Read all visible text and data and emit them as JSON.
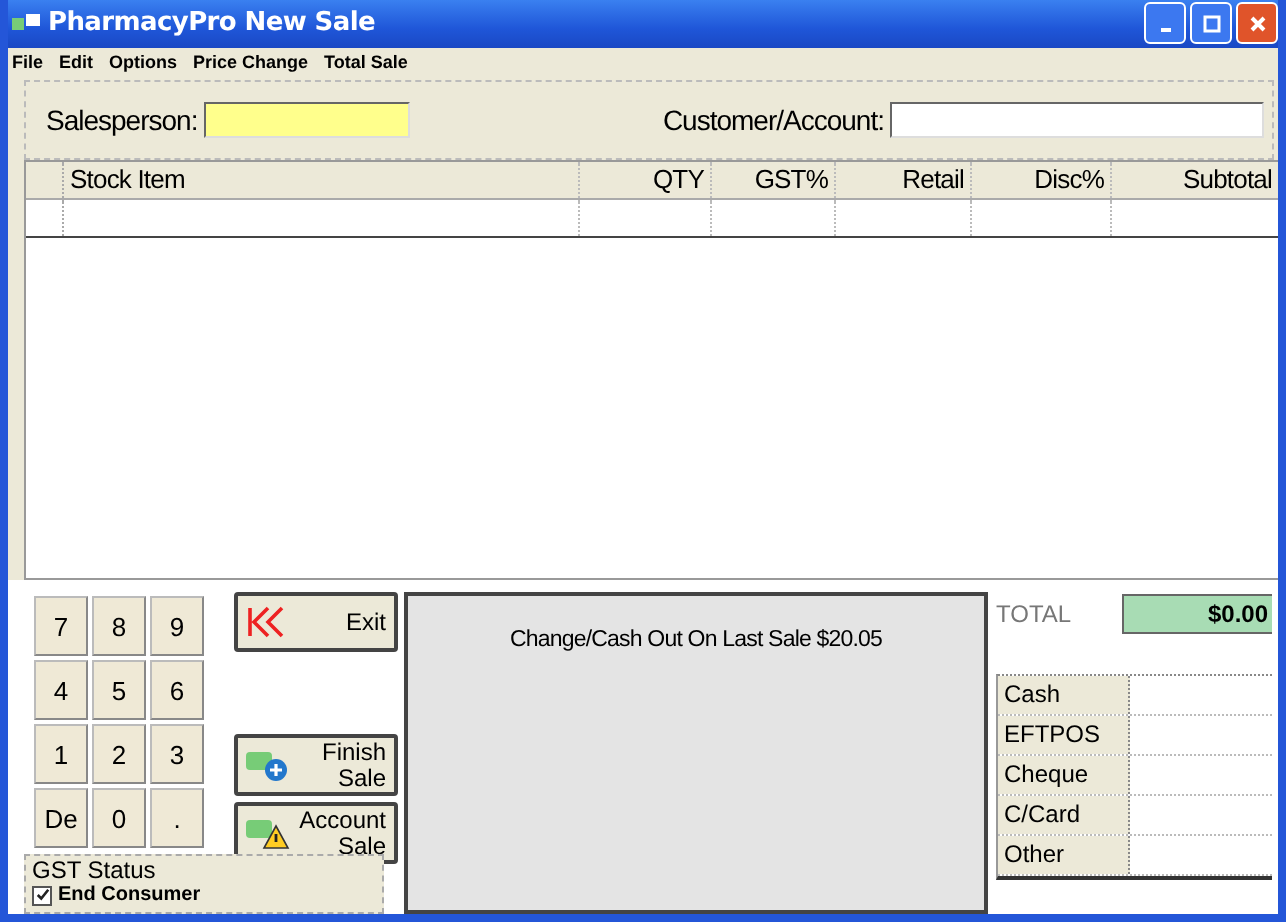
{
  "window": {
    "title": "PharmacyPro New Sale"
  },
  "menu": [
    "File",
    "Edit",
    "Options",
    "Price Change",
    "Total Sale"
  ],
  "salesperson": {
    "label": "Salesperson:"
  },
  "customer": {
    "label": "Customer/Account:"
  },
  "table": {
    "columns": [
      "Stock Item",
      "QTY",
      "GST%",
      "Retail",
      "Disc%",
      "Subtotal"
    ]
  },
  "keypad": [
    "7",
    "8",
    "9",
    "4",
    "5",
    "6",
    "1",
    "2",
    "3",
    "De",
    "0",
    "."
  ],
  "actions": [
    {
      "kind": "exit",
      "label": "Exit"
    },
    {
      "kind": "finish",
      "label": "Finish Sale"
    },
    {
      "kind": "account",
      "label": "Account Sale"
    }
  ],
  "message": "Change/Cash Out On Last Sale $20.05",
  "total": {
    "label": "TOTAL",
    "value": "$0.00"
  },
  "payments": [
    "Cash",
    "EFTPOS",
    "Cheque",
    "C/Card",
    "Other"
  ],
  "gst_status": {
    "title": "GST Status",
    "option": {
      "label": "End Consumer",
      "checked": true
    }
  }
}
